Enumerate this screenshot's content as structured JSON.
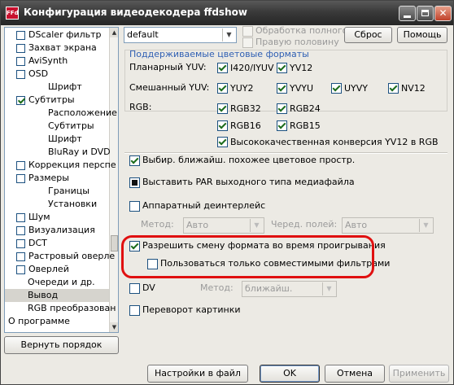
{
  "window": {
    "title": "Конфигурация видеодекодера ffdshow",
    "app_icon_text": "FFd"
  },
  "sidebar": {
    "items": [
      {
        "label": "DScaler фильтр",
        "checkbox": true,
        "checked": false,
        "indent": 0
      },
      {
        "label": "Захват экрана",
        "checkbox": true,
        "checked": false,
        "indent": 0
      },
      {
        "label": "AviSynth",
        "checkbox": true,
        "checked": false,
        "indent": 0
      },
      {
        "label": "OSD",
        "checkbox": true,
        "checked": false,
        "indent": 0
      },
      {
        "label": "Шрифт",
        "checkbox": false,
        "checked": false,
        "indent": 1
      },
      {
        "label": "Субтитры",
        "checkbox": true,
        "checked": true,
        "indent": 0
      },
      {
        "label": "Расположение",
        "checkbox": false,
        "checked": false,
        "indent": 2
      },
      {
        "label": "Субтитры",
        "checkbox": false,
        "checked": false,
        "indent": 2
      },
      {
        "label": "Шрифт",
        "checkbox": false,
        "checked": false,
        "indent": 2
      },
      {
        "label": "BluRay и DVD",
        "checkbox": false,
        "checked": false,
        "indent": 2
      },
      {
        "label": "Коррекция перспе",
        "checkbox": true,
        "checked": false,
        "indent": 0
      },
      {
        "label": "Размеры",
        "checkbox": true,
        "checked": false,
        "indent": 0
      },
      {
        "label": "Границы",
        "checkbox": false,
        "checked": false,
        "indent": 2
      },
      {
        "label": "Установки",
        "checkbox": false,
        "checked": false,
        "indent": 2
      },
      {
        "label": "Шум",
        "checkbox": true,
        "checked": false,
        "indent": 0
      },
      {
        "label": "Визуализация",
        "checkbox": true,
        "checked": false,
        "indent": 0
      },
      {
        "label": "DCT",
        "checkbox": true,
        "checked": false,
        "indent": 0
      },
      {
        "label": "Растровый оверле",
        "checkbox": true,
        "checked": false,
        "indent": 0
      },
      {
        "label": "Оверлей",
        "checkbox": true,
        "checked": false,
        "indent": 0
      },
      {
        "label": "Очереди и др.",
        "checkbox": false,
        "checked": false,
        "indent": 1
      },
      {
        "label": "Вывод",
        "checkbox": false,
        "checked": false,
        "indent": 1,
        "selected": true
      },
      {
        "label": "RGB преобразован",
        "checkbox": false,
        "checked": false,
        "indent": 1
      },
      {
        "label": "О программе",
        "checkbox": false,
        "checked": false,
        "indent": -1
      }
    ],
    "reorder_button": "Вернуть порядок"
  },
  "top": {
    "preset": "default",
    "process_whole_label": "Обработка полного",
    "right_half_label": "Правую половину",
    "reset_button": "Сброс",
    "help_button": "Помощь"
  },
  "formats": {
    "header": "Поддерживаемые цветовые форматы",
    "planar_label": "Планарный YUV:",
    "planar": [
      {
        "label": "I420/IYUV",
        "checked": true
      },
      {
        "label": "YV12",
        "checked": true
      }
    ],
    "mixed_label": "Смешанный YUV:",
    "mixed": [
      {
        "label": "YUY2",
        "checked": true
      },
      {
        "label": "YVYU",
        "checked": true
      },
      {
        "label": "UYVY",
        "checked": true
      },
      {
        "label": "NV12",
        "checked": true
      }
    ],
    "rgb_label": "RGB:",
    "rgb": [
      {
        "label": "RGB32",
        "checked": true
      },
      {
        "label": "RGB24",
        "checked": true
      },
      {
        "label": "RGB16",
        "checked": true
      },
      {
        "label": "RGB15",
        "checked": true
      }
    ],
    "hq_conversion": {
      "label": "Высококачественная конверсия YV12 в RGB",
      "checked": true
    }
  },
  "options": {
    "nearest_colorspace": {
      "label": "Выбир. ближайш. похожее цветовое простр.",
      "checked": true
    },
    "output_par": {
      "label": "Выставить PAR выходного типа медиафайла",
      "state": "indeterminate"
    },
    "hw_deinterlace": {
      "label": "Аппаратный деинтерлейс",
      "checked": false
    },
    "method_label": "Метод:",
    "method_value": "Авто",
    "field_order_label": "Черед. полей:",
    "field_order_value": "Авто",
    "allow_format_change": {
      "label": "Разрешить смену формата во время проигрывания",
      "checked": true
    },
    "compatible_only": {
      "label": "Пользоваться только совместимыми фильтрами",
      "checked": false
    },
    "dv": {
      "label": "DV",
      "checked": false
    },
    "dv_method_label": "Метод:",
    "dv_method_value": "ближайш.",
    "flip": {
      "label": "Переворот картинки",
      "checked": false
    }
  },
  "footer": {
    "save_settings": "Настройки в файл",
    "ok": "OK",
    "cancel": "Отмена",
    "apply": "Применить"
  }
}
